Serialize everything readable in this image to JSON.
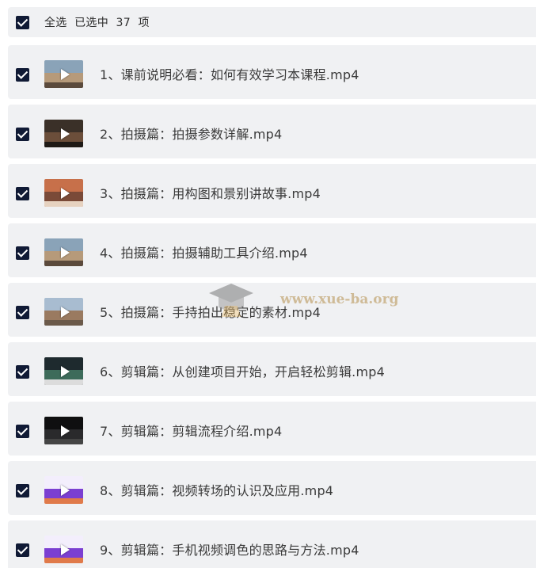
{
  "header": {
    "select_all": "全选",
    "selected_text": "已选中",
    "selected_count": "37",
    "unit": "项"
  },
  "items": [
    {
      "title": "1、课前说明必看：如何有效学习本课程.mp4",
      "thumb": "outdoor"
    },
    {
      "title": "2、拍摄篇：拍摄参数详解.mp4",
      "thumb": "dark-indoor"
    },
    {
      "title": "3、拍摄篇：用构图和景别讲故事.mp4",
      "thumb": "warm"
    },
    {
      "title": "4、拍摄篇：拍摄辅助工具介绍.mp4",
      "thumb": "outdoor"
    },
    {
      "title": "5、拍摄篇：手持拍出稳定的素材.mp4",
      "thumb": "city"
    },
    {
      "title": "6、剪辑篇：从创建项目开始，开启轻松剪辑.mp4",
      "thumb": "editor"
    },
    {
      "title": "7、剪辑篇：剪辑流程介绍.mp4",
      "thumb": "black"
    },
    {
      "title": "8、剪辑篇：视频转场的认识及应用.mp4",
      "thumb": "purple"
    },
    {
      "title": "9、剪辑篇：手机视频调色的思路与方法.mp4",
      "thumb": "purple"
    }
  ],
  "watermark": {
    "text": "www.xue-ba.org"
  },
  "colors": {
    "checkbox": "#101a35",
    "row_bg": "#f0f1f3",
    "text": "#3a3a3a"
  }
}
